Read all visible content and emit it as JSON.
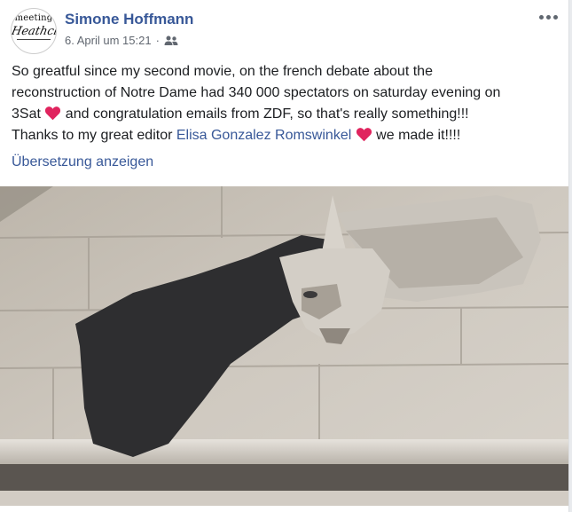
{
  "post": {
    "author": "Simone Hoffmann",
    "avatar_text_top": "meeting",
    "avatar_text_bottom": "Heathcliff",
    "date": "6. April um 15:21",
    "separator": "·",
    "audience_icon": "friends-icon",
    "more_icon": "more-options-icon",
    "text": {
      "line1": "So greatful since my second movie, on the french debate about the",
      "line2": "reconstruction of Notre Dame had 340 000 spectators on saturday evening on",
      "line3a": "3Sat ",
      "line3b": " and congratulation emails from ZDF, so that's really something!!!",
      "line4a": "Thanks to my great editor ",
      "mention": "Elisa Gonzalez Romswinkel",
      "line4b": " we made it!!!!"
    },
    "emoji": "red-heart",
    "translate_label": "Übersetzung anzeigen"
  },
  "colors": {
    "link": "#385898",
    "text": "#1c1e21",
    "meta": "#616770",
    "heart": "#e0245e",
    "stone": "#c9c4bc",
    "shadow": "#2e2e30"
  }
}
